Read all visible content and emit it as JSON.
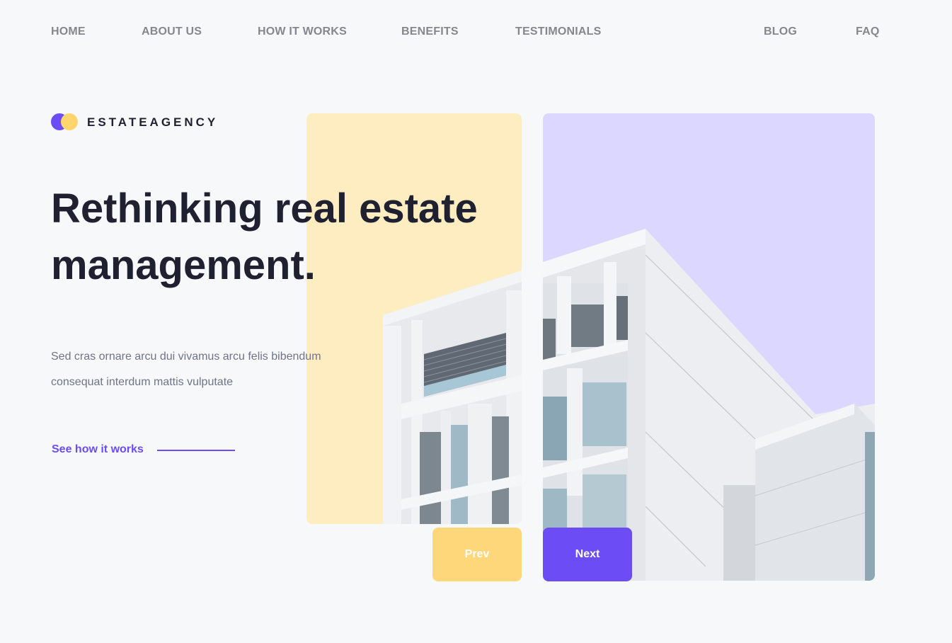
{
  "nav": {
    "items": [
      {
        "label": "HOME"
      },
      {
        "label": "ABOUT US"
      },
      {
        "label": "HOW IT WORKS"
      },
      {
        "label": "BENEFITS"
      },
      {
        "label": "TESTIMONIALS"
      },
      {
        "label": "BLOG"
      },
      {
        "label": "FAQ"
      }
    ]
  },
  "brand": {
    "name": "ESTATEAGENCY"
  },
  "hero": {
    "headline": "Rethinking real estate management.",
    "subtext": "Sed cras ornare arcu dui vivamus arcu felis bibendum consequat interdum mattis vulputate",
    "cta_label": "See how it works"
  },
  "slider": {
    "prev_label": "Prev",
    "next_label": "Next"
  },
  "colors": {
    "accent": "#6c4cf5",
    "yellow": "#ffd66e",
    "card_yellow": "#ffedc2",
    "card_purple": "#dcd7ff",
    "text_dark": "#1f2030",
    "nav_text": "#86878c"
  }
}
